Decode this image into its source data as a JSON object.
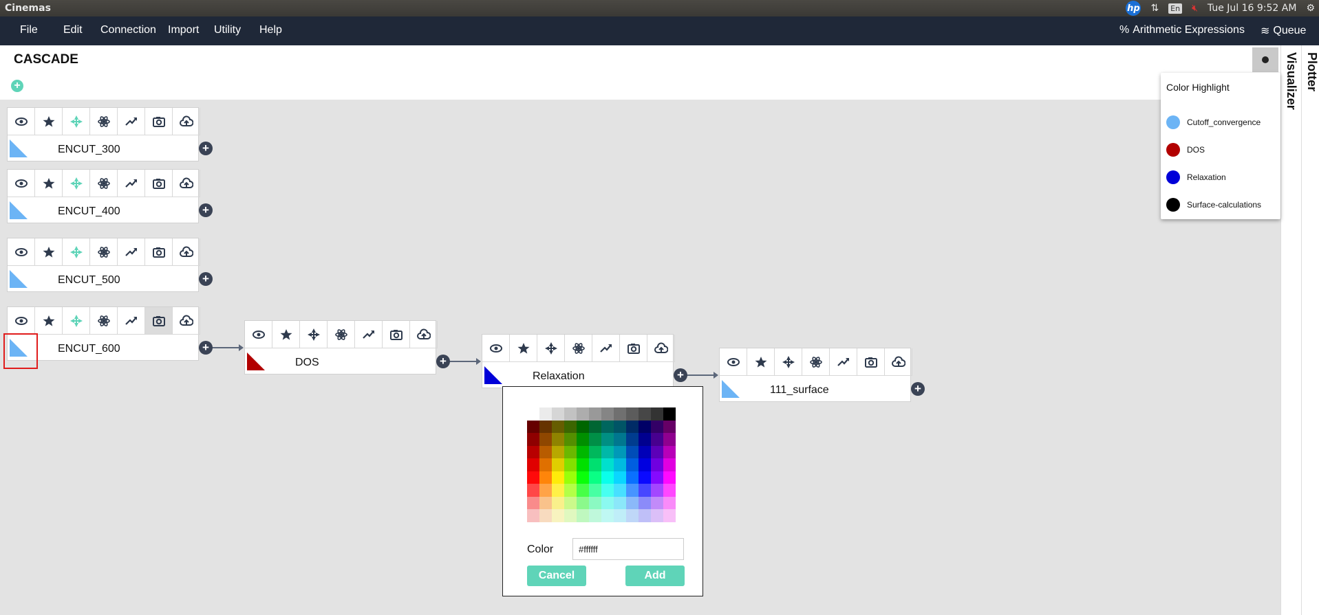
{
  "os": {
    "app_title": "Cinemas",
    "input_method": "En",
    "clock": "Tue Jul 16  9:52 AM"
  },
  "menu": {
    "items": [
      "File",
      "Edit",
      "Connection",
      "Import",
      "Utility",
      "Help"
    ],
    "arith_label": "Arithmetic Expressions",
    "queue_label": "Queue"
  },
  "page": {
    "title": "CASCADE",
    "add_symbol": "+"
  },
  "tabs": {
    "visualizer": "Visualizer",
    "plotter": "Plotter"
  },
  "highlight": {
    "title": "Color Highlight",
    "items": [
      {
        "label": "Cutoff_convergence",
        "color": "#6cb4f5"
      },
      {
        "label": "DOS",
        "color": "#b20000"
      },
      {
        "label": "Relaxation",
        "color": "#0000d8"
      },
      {
        "label": "Surface-calculations",
        "color": "#000000"
      }
    ]
  },
  "nodes": [
    {
      "label": "ENCUT_300",
      "color": "#6cb4f5"
    },
    {
      "label": "ENCUT_400",
      "color": "#6cb4f5"
    },
    {
      "label": "ENCUT_500",
      "color": "#6cb4f5"
    },
    {
      "label": "ENCUT_600",
      "color": "#6cb4f5"
    },
    {
      "label": "DOS",
      "color": "#b20000"
    },
    {
      "label": "Relaxation",
      "color": "#0000d8"
    },
    {
      "label": "111_surface",
      "color": "#6cb4f5"
    }
  ],
  "node_plus": "+",
  "picker": {
    "color_label": "Color",
    "color_value": "#ffffff",
    "cancel_label": "Cancel",
    "add_label": "Add"
  },
  "colors": {
    "accent": "#5fd4b8",
    "menubar": "#1f2838"
  }
}
